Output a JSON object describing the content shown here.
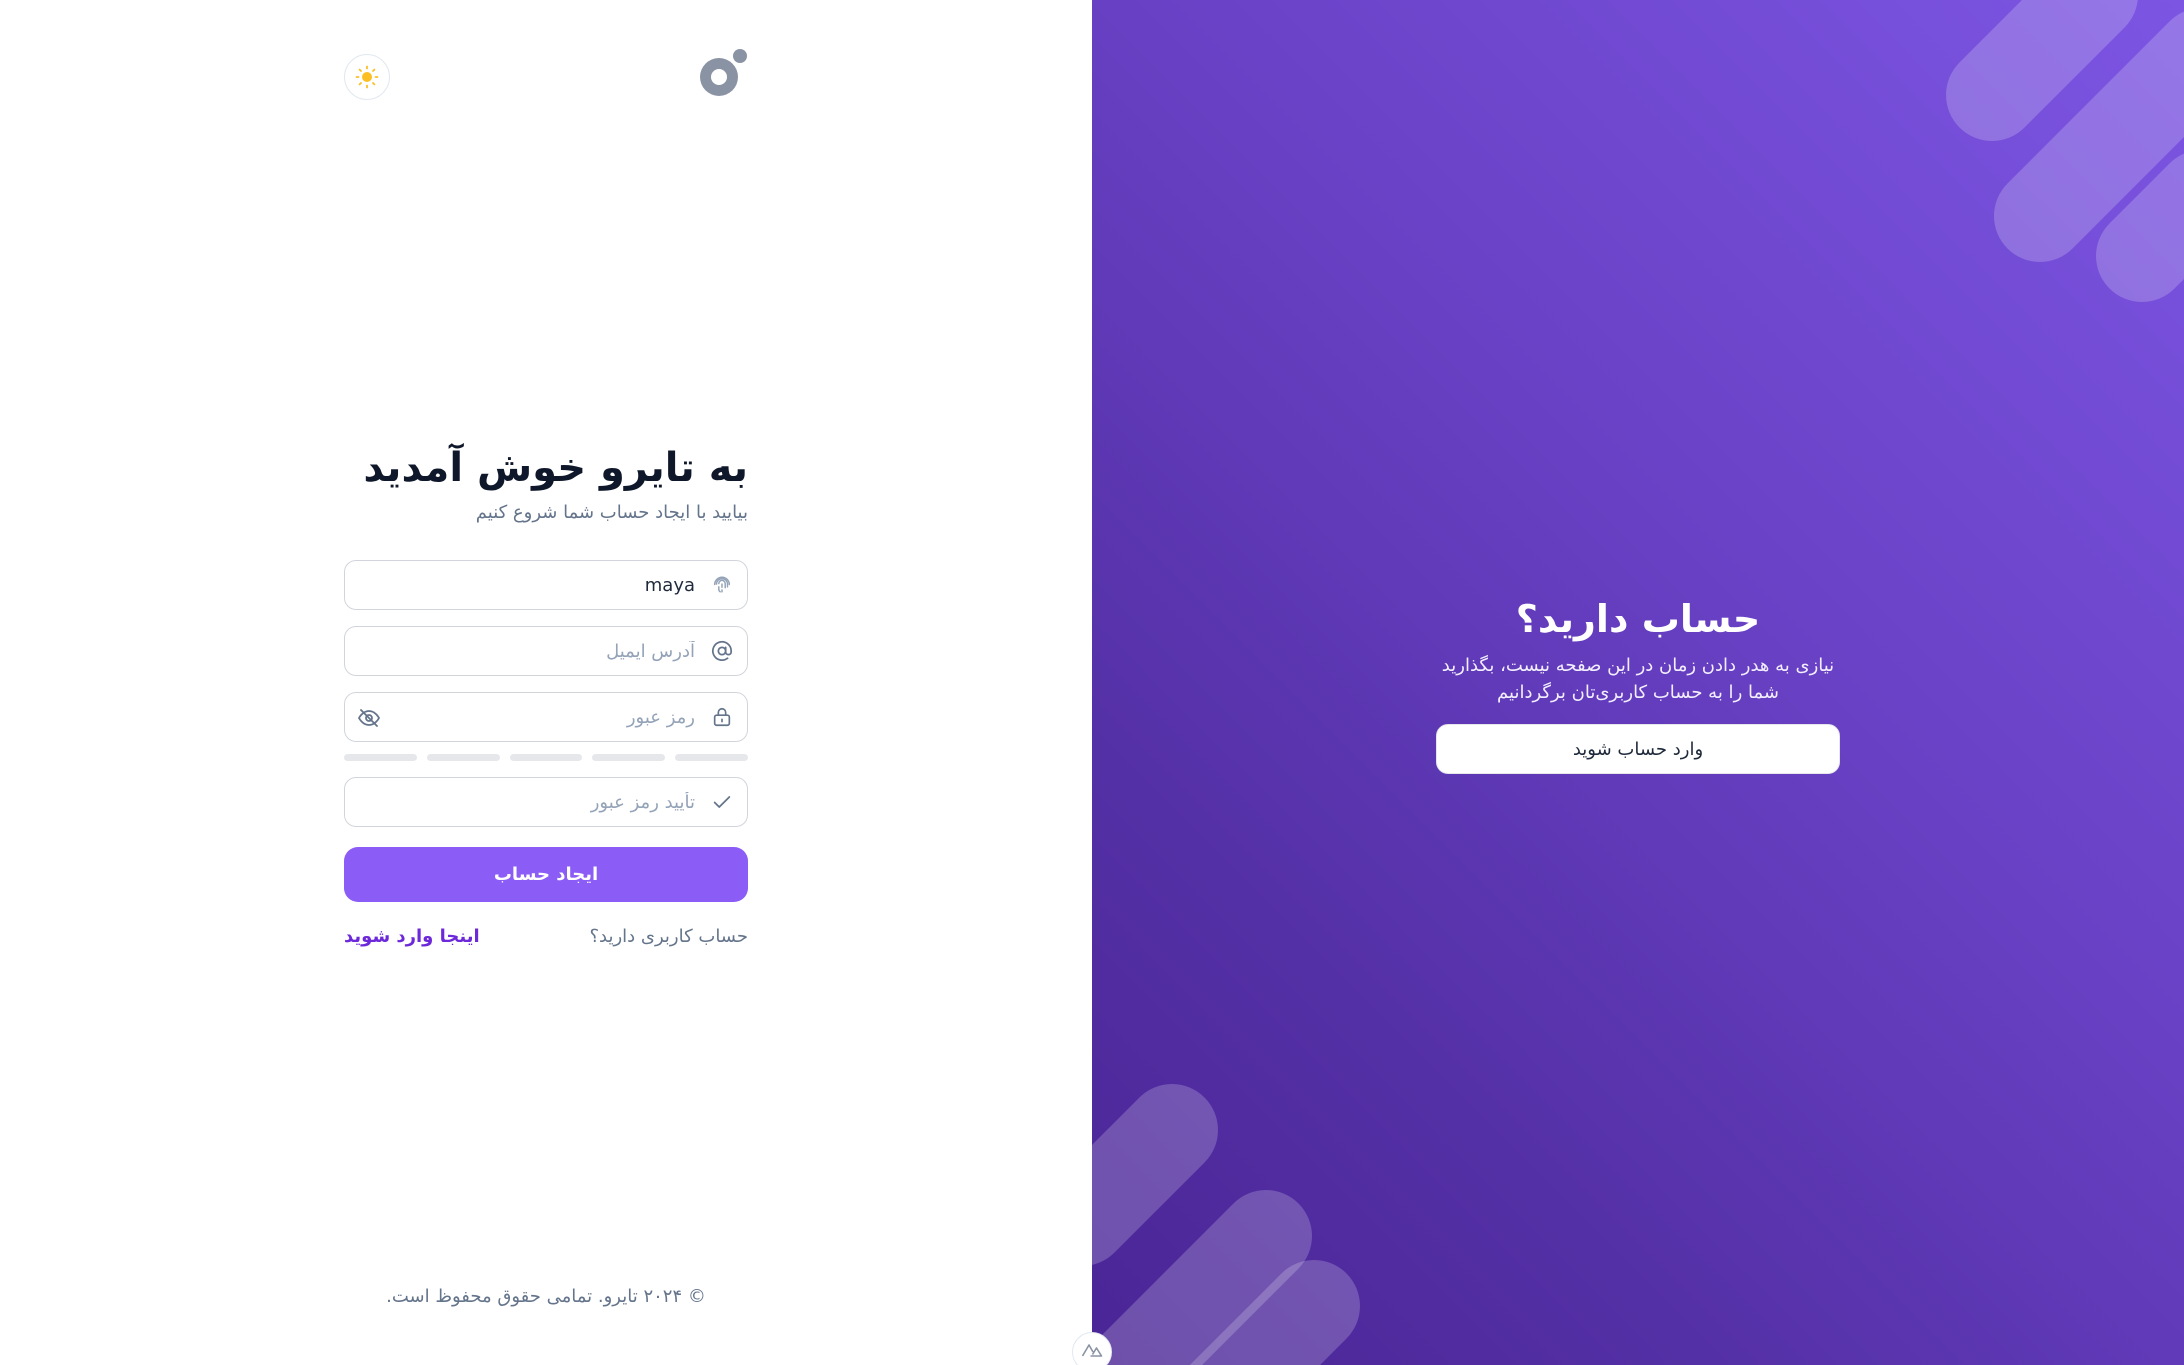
{
  "brand": {
    "logo_icon": "tairo-logo-icon",
    "accent": "#8b5cf6"
  },
  "theme_toggle": {
    "icon": "sun-icon"
  },
  "form": {
    "title": "به تایرو خوش آمدید",
    "subtitle": "بیایید با ایجاد حساب شما شروع کنیم",
    "username": {
      "value": "maya",
      "icon": "fingerprint-icon"
    },
    "email": {
      "placeholder": "آدرس ایمیل",
      "icon": "at-sign-icon"
    },
    "password": {
      "placeholder": "رمز عبور",
      "icon": "lock-icon",
      "toggle_icon": "eye-off-icon"
    },
    "confirm_password": {
      "placeholder": "تأیید رمز عبور",
      "icon": "check-icon"
    },
    "submit_label": "ایجاد حساب",
    "signin_question": "حساب کاربری دارید؟",
    "signin_link": "اینجا وارد شوید"
  },
  "footer": {
    "text": "© ۲۰۲۴ تایرو. تمامی حقوق محفوظ است."
  },
  "promo": {
    "title": "حساب دارید؟",
    "text": "نیازی به هدر دادن زمان در این صفحه نیست، بگذارید شما را به حساب کاربری‌تان برگردانیم",
    "button_label": "وارد حساب شوید",
    "background_start": "#7c55e3",
    "background_end": "#4a2596"
  }
}
